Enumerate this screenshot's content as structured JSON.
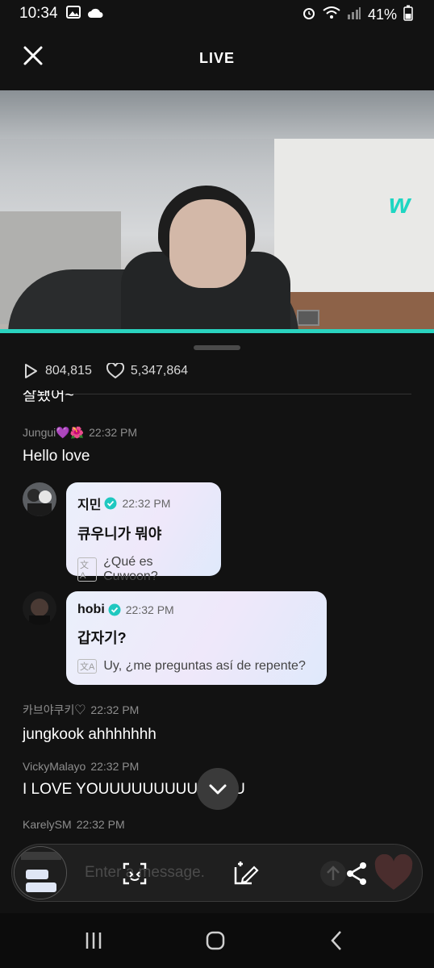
{
  "status": {
    "time": "10:34",
    "battery": "41%"
  },
  "header": {
    "title": "LIVE"
  },
  "video": {
    "logo": "w",
    "progress_fraction": 1.0
  },
  "stats": {
    "plays": "804,815",
    "likes": "5,347,864"
  },
  "chat": {
    "cut_text": "잘됐어~",
    "messages": [
      {
        "user": "Jungui💜🌺",
        "time": "22:32 PM",
        "text": "Hello love"
      },
      {
        "user": "카브야쿠키♡",
        "time": "22:32 PM",
        "text": "jungkook ahhhhhhh"
      },
      {
        "user": "VickyMalayo",
        "time": "22:32 PM",
        "text": "I LOVE YOUUUUUUUUU",
        "text_tail": "U"
      },
      {
        "user": "KarelySM",
        "time": "22:32 PM"
      }
    ],
    "artist_messages": [
      {
        "name": "지민",
        "time": "22:32 PM",
        "text": "큐우니가 뭐야",
        "translation": "¿Qué es Cuwoon?"
      },
      {
        "name": "hobi",
        "time": "22:32 PM",
        "text": "갑자기?",
        "translation": "Uy, ¿me preguntas así de repente?"
      }
    ]
  },
  "toolbar": {
    "placeholder": "Enter a message."
  },
  "colors": {
    "accent": "#2ad3bf",
    "background": "#121212",
    "bubble": "#eaf0fb",
    "verified": "#1fc8c0"
  },
  "icons": [
    "close-icon",
    "play-icon",
    "heart-icon",
    "scan-icon",
    "edit-icon",
    "share-icon",
    "chevron-down-icon",
    "verified-icon",
    "translate-icon"
  ]
}
